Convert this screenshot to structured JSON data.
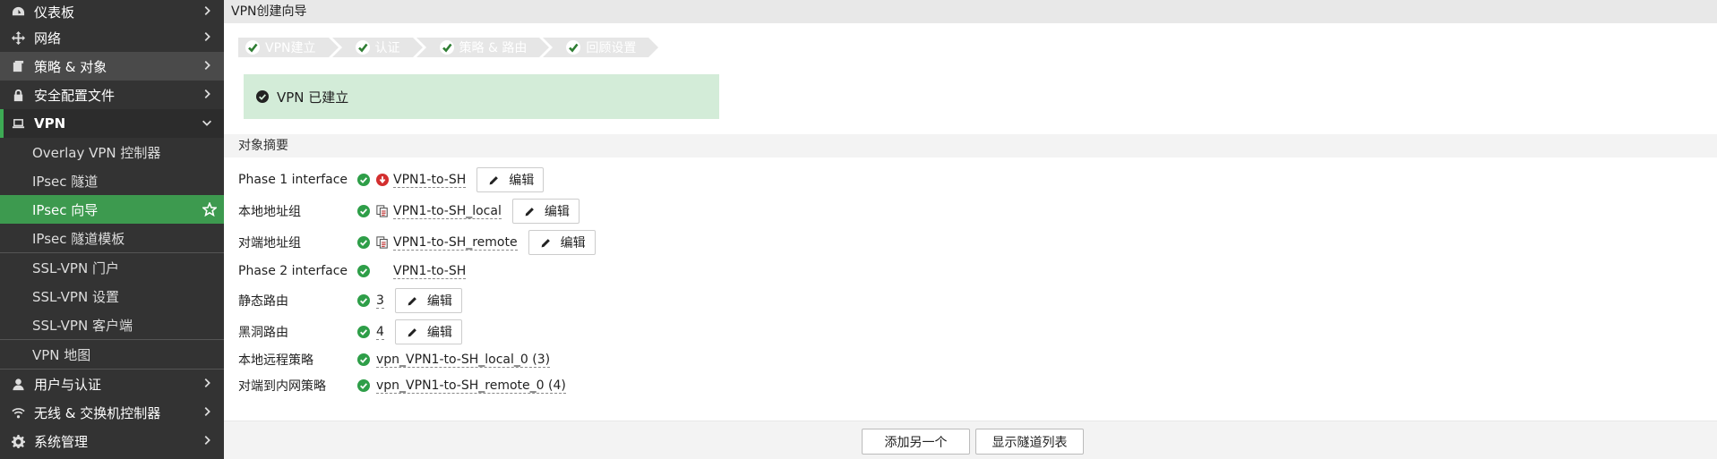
{
  "sidebar": {
    "items": [
      {
        "label": "仪表板",
        "icon": "dashboard-icon"
      },
      {
        "label": "网络",
        "icon": "network-move-icon"
      },
      {
        "label": "策略 & 对象",
        "icon": "policy-objects-icon"
      },
      {
        "label": "安全配置文件",
        "icon": "lock-icon"
      },
      {
        "label": "VPN",
        "icon": "laptop-icon"
      },
      {
        "label": "用户与认证",
        "icon": "user-icon"
      },
      {
        "label": "无线 & 交换机控制器",
        "icon": "wifi-icon"
      },
      {
        "label": "系统管理",
        "icon": "gear-icon"
      }
    ],
    "vpn_sub": [
      {
        "label": "Overlay VPN 控制器"
      },
      {
        "label": "IPsec 隧道"
      },
      {
        "label": "IPsec 向导"
      },
      {
        "label": "IPsec 隧道模板"
      },
      {
        "label": "SSL-VPN 门户"
      },
      {
        "label": "SSL-VPN 设置"
      },
      {
        "label": "SSL-VPN 客户端"
      },
      {
        "label": "VPN 地图"
      }
    ]
  },
  "main": {
    "title": "VPN创建向导",
    "steps": [
      "VPN建立",
      "认证",
      "策略 & 路由",
      "回顾设置"
    ],
    "banner": "VPN 已建立",
    "section_title": "对象摘要",
    "rows": [
      {
        "label": "Phase 1 interface",
        "value": "VPN1-to-SH",
        "icon": "tunnel-down-icon",
        "edit": "编辑"
      },
      {
        "label": "本地地址组",
        "value": "VPN1-to-SH_local",
        "icon": "address-group-icon",
        "edit": "编辑"
      },
      {
        "label": "对端地址组",
        "value": "VPN1-to-SH_remote",
        "icon": "address-group-icon",
        "edit": "编辑"
      },
      {
        "label": "Phase 2 interface",
        "value": "VPN1-to-SH",
        "icon": "",
        "edit": ""
      },
      {
        "label": "静态路由",
        "value": "3",
        "icon": "",
        "edit": "编辑"
      },
      {
        "label": "黑洞路由",
        "value": "4",
        "icon": "",
        "edit": "编辑"
      },
      {
        "label": "本地远程策略",
        "value": "vpn_VPN1-to-SH_local_0 (3)",
        "icon": "",
        "edit": ""
      },
      {
        "label": "对端到内网策略",
        "value": "vpn_VPN1-to-SH_remote_0 (4)",
        "icon": "",
        "edit": ""
      }
    ],
    "buttons": {
      "add_another": "添加另一个",
      "show_tunnels": "显示隧道列表"
    }
  },
  "colors": {
    "sidebar_bg": "#333333",
    "accent_green": "#3d9a4f",
    "banner_bg": "#d3ecd8",
    "ok_green": "#2e9e48",
    "down_red": "#d32f2f"
  }
}
